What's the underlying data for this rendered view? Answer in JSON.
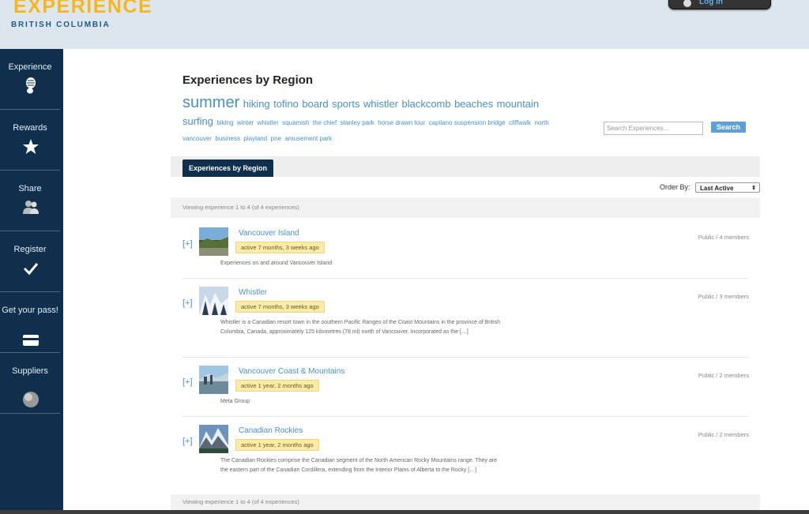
{
  "brand": {
    "line1": "EXPERIENCE",
    "line2": "BRITISH COLUMBIA"
  },
  "header": {
    "login_label": "Log In"
  },
  "sidebar": {
    "items": [
      {
        "label": "Experience",
        "icon": "footprint-icon"
      },
      {
        "label": "Rewards",
        "icon": "star-icon"
      },
      {
        "label": "Share",
        "icon": "users-icon"
      },
      {
        "label": "Register",
        "icon": "checkmark-icon"
      },
      {
        "label": "Get your pass!",
        "icon": "card-icon"
      },
      {
        "label": "Suppliers",
        "icon": "globe-icon"
      }
    ]
  },
  "main": {
    "title": "Experiences by Region",
    "tags": [
      {
        "text": "summer",
        "size": 20
      },
      {
        "text": "hiking",
        "size": 13
      },
      {
        "text": "tofino",
        "size": 13
      },
      {
        "text": "board",
        "size": 13
      },
      {
        "text": "sports",
        "size": 13
      },
      {
        "text": "whistler",
        "size": 13
      },
      {
        "text": "blackcomb",
        "size": 13
      },
      {
        "text": "beaches",
        "size": 13
      },
      {
        "text": "mountain",
        "size": 13
      },
      {
        "text": "surfing",
        "size": 13
      },
      {
        "text": "biking",
        "size": 8
      },
      {
        "text": "winter",
        "size": 8
      },
      {
        "text": "whistler",
        "size": 8
      },
      {
        "text": "squamish",
        "size": 8
      },
      {
        "text": "the chief",
        "size": 8
      },
      {
        "text": "stanley park",
        "size": 8
      },
      {
        "text": "horse drawn tour",
        "size": 8
      },
      {
        "text": "capilano suspension bridge",
        "size": 8
      },
      {
        "text": "cliffwalk",
        "size": 8
      },
      {
        "text": "north vancouver",
        "size": 8
      },
      {
        "text": "business",
        "size": 8
      },
      {
        "text": "playland",
        "size": 8
      },
      {
        "text": "pne",
        "size": 8
      },
      {
        "text": "amusement park",
        "size": 8
      }
    ],
    "search": {
      "placeholder": "Search Experiences...",
      "button": "Search"
    },
    "tab_label": "Experiences by Region",
    "order_by": {
      "label": "Order By:",
      "value": "Last Active"
    },
    "viewing_text": "Viewing experience 1 to 4 (of 4 experiences)",
    "viewing_text_bottom": "Viewing experience 1 to 4 (of 4 experiences)",
    "rows": [
      {
        "plus": "[+]",
        "title": "Vancouver Island",
        "activity": "active 7 months, 3 weeks ago",
        "meta": "Public / 4 members",
        "desc": "Experiences on and around Vancouver Island"
      },
      {
        "plus": "[+]",
        "title": "Whistler",
        "activity": "active 7 months, 3 weeks ago",
        "meta": "Public / 3 members",
        "desc": "Whistler is a Canadian resort town in the southern Pacific Ranges of the Coast Mountains in the province of British Columbia, Canada, approximately 125 kilometres (78 mi) north of Vancouver. Incorporated as the […]"
      },
      {
        "plus": "[+]",
        "title": "Vancouver Coast & Mountains",
        "activity": "active 1 year, 2 months ago",
        "meta": "Public / 2 members",
        "desc": "Meta Group"
      },
      {
        "plus": "[+]",
        "title": "Canadian Rockies",
        "activity": "active 1 year, 2 months ago",
        "meta": "Public / 2 members",
        "desc": "The Canadian Rockies comprise the Canadian segment of the North American Rocky Mountains range. They are the eastern part of the Canadian Cordillera, extending from the Interior Plains of Alberta to the Rocky […]"
      }
    ]
  }
}
